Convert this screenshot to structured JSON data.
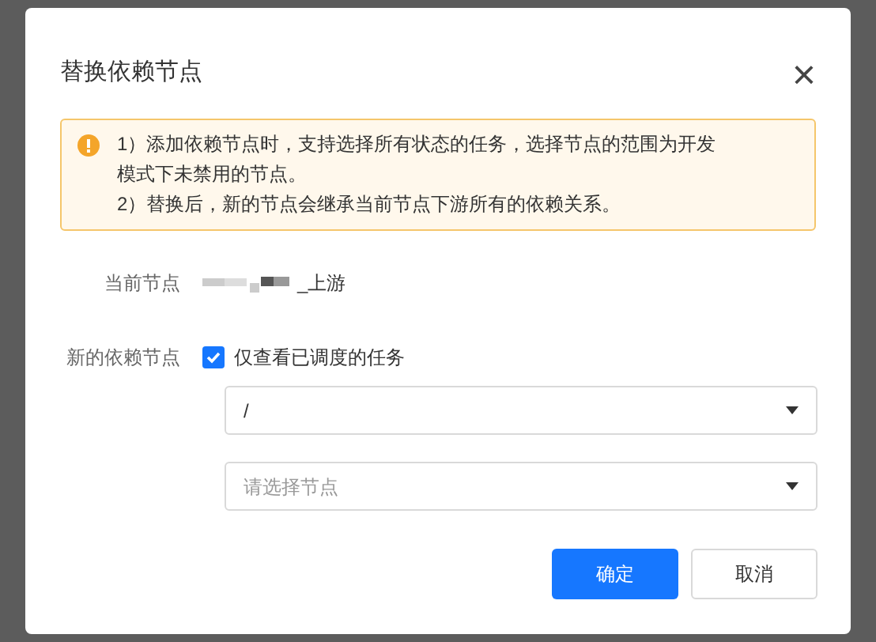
{
  "dialog": {
    "title": "替换依赖节点",
    "close": "×"
  },
  "notice": {
    "lines": [
      "1）添加依赖节点时，支持选择所有状态的任务，选择节点的范围为开发模式下未禁用的节点。",
      "2）替换后，新的节点会继承当前节点下游所有的依赖关系。"
    ]
  },
  "current_node": {
    "label": "当前节点",
    "value": "_上游"
  },
  "new_node": {
    "label": "新的依赖节点",
    "checkbox": {
      "label": "仅查看已调度的任务",
      "checked": true
    },
    "path_select": {
      "value": "/"
    },
    "node_select": {
      "placeholder": "请选择节点"
    }
  },
  "buttons": [
    {
      "label": "确定",
      "kind": "primary"
    },
    {
      "label": "取消",
      "kind": "default"
    }
  ]
}
